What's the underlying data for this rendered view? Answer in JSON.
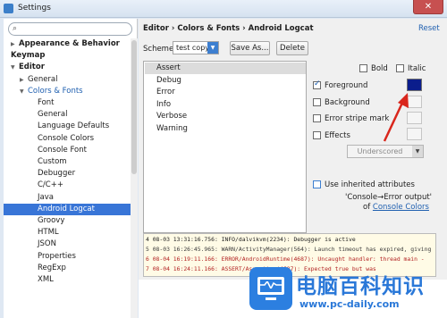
{
  "window": {
    "title": "Settings",
    "close_glyph": "✕"
  },
  "search": {
    "value": "",
    "placeholder": ""
  },
  "tree": [
    {
      "label": "Appearance & Behavior",
      "bold": true,
      "arrow": "▶"
    },
    {
      "label": "Keymap",
      "bold": true,
      "arrow": ""
    },
    {
      "label": "Editor",
      "bold": true,
      "arrow": "▼"
    },
    {
      "label": "General",
      "bold": false,
      "arrow": "▶"
    },
    {
      "label": "Colors & Fonts",
      "bold": false,
      "arrow": "▼",
      "accent": true
    },
    {
      "label": "Font"
    },
    {
      "label": "General"
    },
    {
      "label": "Language Defaults"
    },
    {
      "label": "Console Colors"
    },
    {
      "label": "Console Font"
    },
    {
      "label": "Custom"
    },
    {
      "label": "Debugger"
    },
    {
      "label": "C/C++"
    },
    {
      "label": "Java"
    },
    {
      "label": "Android Logcat",
      "selected": true
    },
    {
      "label": "Groovy"
    },
    {
      "label": "HTML"
    },
    {
      "label": "JSON"
    },
    {
      "label": "Properties"
    },
    {
      "label": "RegExp"
    },
    {
      "label": "XML"
    }
  ],
  "breadcrumb": "Editor › Colors & Fonts › Android Logcat",
  "reset_label": "Reset",
  "scheme": {
    "label": "Scheme:",
    "value": "test copy",
    "save_as": "Save As...",
    "delete": "Delete"
  },
  "levels": [
    "Assert",
    "Debug",
    "Error",
    "Info",
    "Verbose",
    "Warning"
  ],
  "attrs": {
    "bold": "Bold",
    "italic": "Italic",
    "foreground": "Foreground",
    "background": "Background",
    "error_stripe": "Error stripe mark",
    "effects": "Effects",
    "effect_type": "Underscored",
    "use_inherited": "Use inherited attributes",
    "inherit_from": "'Console→Error output'",
    "of_prefix": "of",
    "of_link": "Console Colors"
  },
  "state": {
    "bold": false,
    "italic": false,
    "foreground": true,
    "background": false,
    "error_stripe": false,
    "effects": false,
    "use_inherited": false
  },
  "colors": {
    "foreground_swatch": "#0b1d8c",
    "selection": "#3875d7",
    "accent_text": "#2060b0"
  },
  "preview_lines": [
    "4 08-03 13:31:16.756: INFO/dalvikvm(2234): Debugger is active",
    "5 08-03 16:26:45.965: WARN/ActivityManager(564): Launch timeout has expired, giving",
    "6 08-04 16:19:11.166: ERROR/AndroidRuntime(4687): Uncaught handler: thread main -",
    "7 08-04 16:24:11.166: ASSERT/Assertion(4687): Expected true but was"
  ],
  "watermark": {
    "title": "电脑百科知识",
    "url": "www.pc-daily.com"
  }
}
